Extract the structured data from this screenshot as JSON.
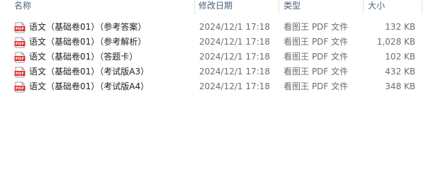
{
  "columns": {
    "name": "名称",
    "date": "修改日期",
    "type": "类型",
    "size": "大小"
  },
  "files": [
    {
      "name": "语文（基础卷01）（参考答案）",
      "date": "2024/12/1 17:18",
      "type": "看图王 PDF 文件",
      "size": "132 KB",
      "icon": "pdf-icon"
    },
    {
      "name": "语文（基础卷01）（参考解析）",
      "date": "2024/12/1 17:18",
      "type": "看图王 PDF 文件",
      "size": "1,028 KB",
      "icon": "pdf-icon"
    },
    {
      "name": "语文（基础卷01）（答题卡）",
      "date": "2024/12/1 17:18",
      "type": "看图王 PDF 文件",
      "size": "102 KB",
      "icon": "pdf-icon"
    },
    {
      "name": "语文（基础卷01）（考试版A3）",
      "date": "2024/12/1 17:18",
      "type": "看图王 PDF 文件",
      "size": "432 KB",
      "icon": "pdf-icon"
    },
    {
      "name": "语文（基础卷01）（考试版A4）",
      "date": "2024/12/1 17:18",
      "type": "看图王 PDF 文件",
      "size": "348 KB",
      "icon": "pdf-icon"
    }
  ],
  "colors": {
    "header_text": "#4c607a",
    "pdf_red": "#d9281e",
    "meta_text": "#6d6d6d"
  }
}
